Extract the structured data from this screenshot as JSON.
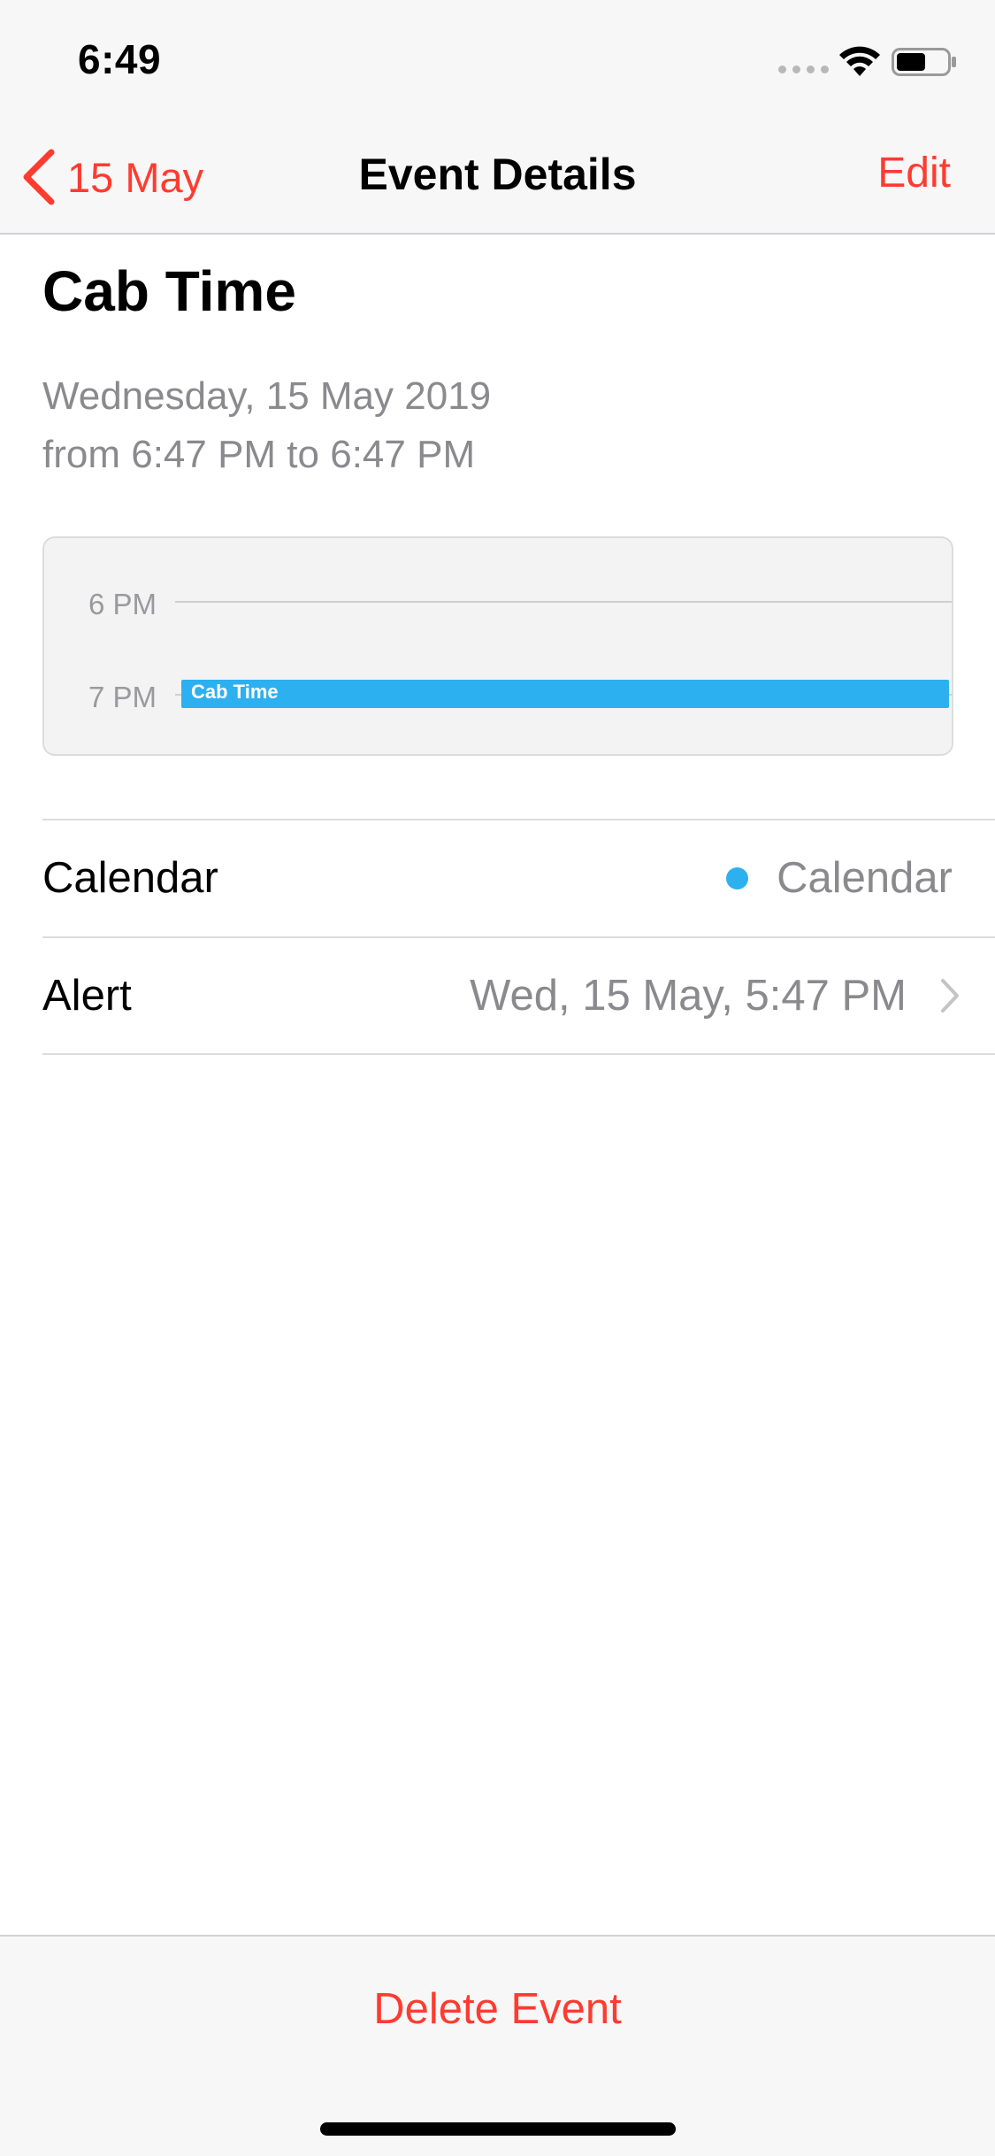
{
  "status_bar": {
    "time": "6:49",
    "icons": [
      "cellular-signal-icon",
      "wifi-icon",
      "battery-icon"
    ]
  },
  "nav": {
    "back_label": "15 May",
    "title": "Event Details",
    "edit_label": "Edit"
  },
  "event": {
    "title": "Cab Time",
    "date": "Wednesday, 15 May 2019",
    "time_range": "from 6:47 PM to 6:47 PM"
  },
  "timeline": {
    "labels": [
      "6 PM",
      "7 PM"
    ],
    "event_label": "Cab Time",
    "event_color": "#2cb0f0"
  },
  "rows": [
    {
      "label": "Calendar",
      "value": "Calendar",
      "dot_color": "#2cb0f0"
    },
    {
      "label": "Alert",
      "value": "Wed, 15 May, 5:47 PM"
    }
  ],
  "toolbar": {
    "delete_label": "Delete Event"
  },
  "colors": {
    "accent": "#ff3b30",
    "secondary_text": "#8a8a8e",
    "bar_background": "#f7f7f7"
  }
}
